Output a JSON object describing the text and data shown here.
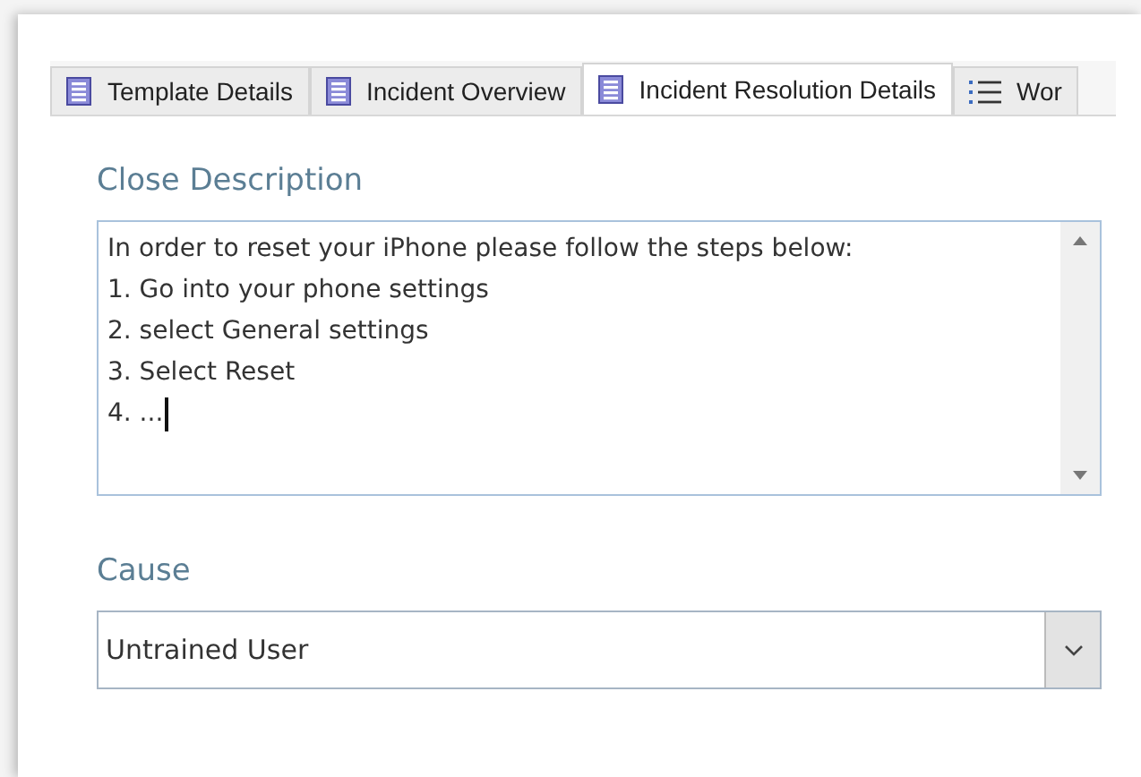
{
  "tabs": [
    {
      "label": "Template Details",
      "kind": "form",
      "selected": false
    },
    {
      "label": "Incident Overview",
      "kind": "form",
      "selected": false
    },
    {
      "label": "Incident Resolution Details",
      "kind": "form",
      "selected": true
    },
    {
      "label": "Wor",
      "kind": "list",
      "selected": false
    }
  ],
  "close_description": {
    "label": "Close Description",
    "lines": [
      "In order to reset your iPhone please follow the steps below:",
      "1. Go into your phone settings",
      "2. select General settings",
      "3. Select Reset",
      "4. ..."
    ]
  },
  "cause": {
    "label": "Cause",
    "value": "Untrained User"
  }
}
